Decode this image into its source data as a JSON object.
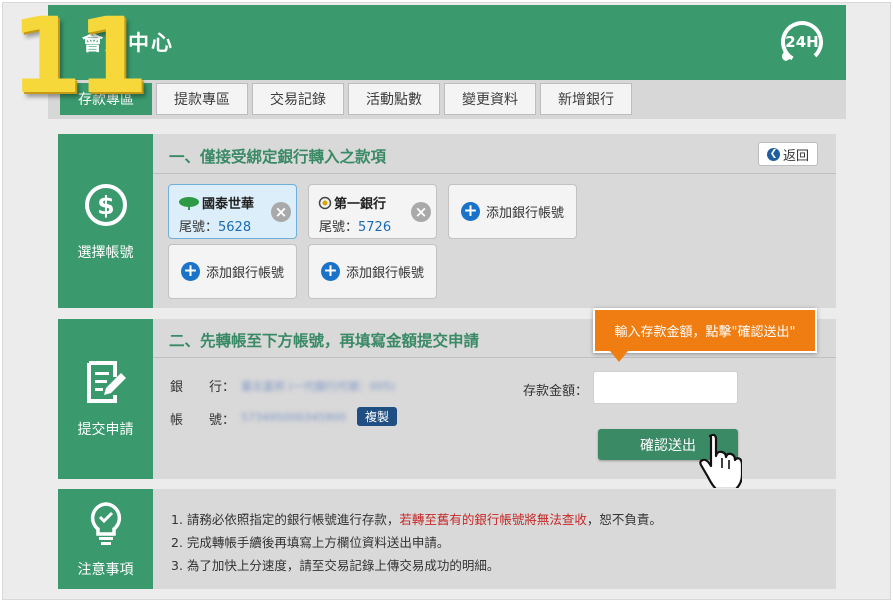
{
  "step_number": "11",
  "header": {
    "title": "會員中心",
    "badge_text": "24H"
  },
  "tabs": [
    {
      "label": "存款專區",
      "active": true
    },
    {
      "label": "提款專區",
      "active": false
    },
    {
      "label": "交易記錄",
      "active": false
    },
    {
      "label": "活動點數",
      "active": false
    },
    {
      "label": "變更資料",
      "active": false
    },
    {
      "label": "新增銀行",
      "active": false
    }
  ],
  "section_accounts": {
    "side_label": "選擇帳號",
    "icon": "dollar-icon",
    "heading": "一、僅接受綁定銀行轉入之款項",
    "back_label": "返回",
    "accounts": [
      {
        "bank": "國泰世華",
        "tail_label": "尾號：",
        "tail_number": "5628",
        "selected": true
      },
      {
        "bank": "第一銀行",
        "tail_label": "尾號：",
        "tail_number": "5726",
        "selected": false
      }
    ],
    "add_label": "添加銀行帳號"
  },
  "section_submit": {
    "side_label": "提交申請",
    "icon": "edit-icon",
    "heading": "二、先轉帳至下方帳號，再填寫金額提交申請",
    "bank_label": "銀　　行：",
    "bank_value": "臺北富邦 (一代銀行代號：005)",
    "account_label": "帳　　號：",
    "account_value": "573495000345900",
    "copy_label": "複製",
    "amount_label": "存款金額：",
    "amount_value": "",
    "submit_label": "確認送出",
    "tooltip": "輸入存款金額，點擊\"確認送出\""
  },
  "section_notes": {
    "side_label": "注意事項",
    "icon": "lightbulb-icon",
    "notes": [
      {
        "prefix": "1. 請務必依照指定的銀行帳號進行存款，",
        "warn": "若轉至舊有的銀行帳號將無法查收",
        "suffix": "，恕不負責。"
      },
      {
        "prefix": "2. 完成轉帳手續後再填寫上方欄位資料送出申請。",
        "warn": "",
        "suffix": ""
      },
      {
        "prefix": "3. 為了加快上分速度，請至交易記錄上傳交易成功的明細。",
        "warn": "",
        "suffix": ""
      }
    ]
  },
  "colors": {
    "primary": "#3a9a6e",
    "accent": "#f07d12",
    "link": "#1a6bb5",
    "warning": "#c62828"
  }
}
